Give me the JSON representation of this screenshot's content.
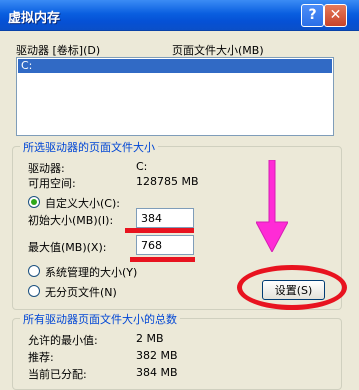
{
  "window": {
    "title": "虚拟内存",
    "help_label": "?",
    "close_label": "✕"
  },
  "drives_header": {
    "drive_col": "驱动器 [卷标](D)",
    "pagefile_col": "页面文件大小(MB)"
  },
  "drives_list": [
    {
      "label": "C:"
    }
  ],
  "selected_group": {
    "legend": "所选驱动器的页面文件大小",
    "drive_label": "驱动器:",
    "drive_value": "C:",
    "space_label": "可用空间:",
    "space_value": "128785 MB",
    "custom_radio": "自定义大小(C):",
    "initial_label": "初始大小(MB)(I):",
    "initial_value": "384",
    "max_label": "最大值(MB)(X):",
    "max_value": "768",
    "system_radio": "系统管理的大小(Y)",
    "nopage_radio": "无分页文件(N)",
    "set_button": "设置(S)"
  },
  "total_group": {
    "legend": "所有驱动器页面文件大小的总数",
    "min_label": "允许的最小值:",
    "min_value": "2 MB",
    "recommended_label": "推荐:",
    "recommended_value": "382 MB",
    "allocated_label": "当前已分配:",
    "allocated_value": "384 MB"
  },
  "colors": {
    "annotation_red": "#e8131f",
    "arrow_magenta": "#ff2bd6",
    "selection_blue": "#316ac5",
    "group_legend_blue": "#0046d5"
  }
}
